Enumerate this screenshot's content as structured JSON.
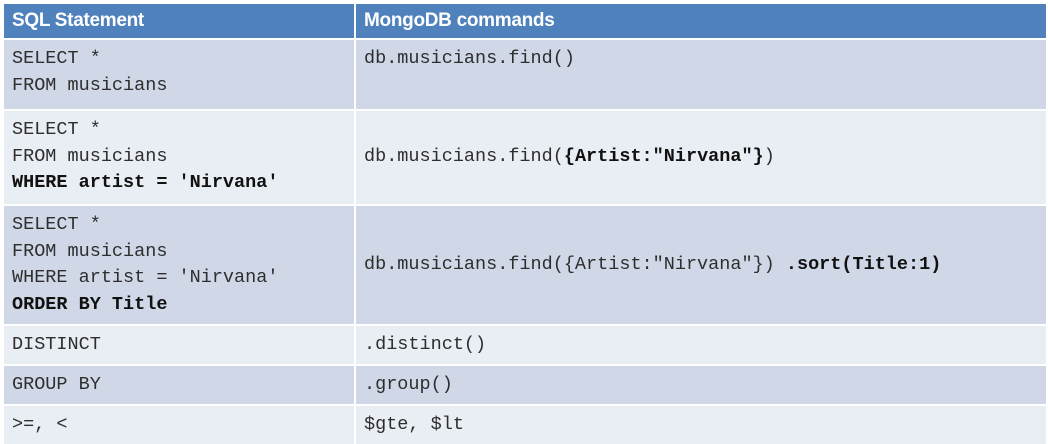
{
  "headers": {
    "sql": "SQL Statement",
    "mongo": "MongoDB commands"
  },
  "rows": [
    {
      "sql": [
        "SELECT *",
        "FROM musicians"
      ],
      "mongo": "db.musicians.find()"
    },
    {
      "sql": [
        "SELECT *",
        "FROM musicians",
        "WHERE artist = 'Nirvana'"
      ],
      "mongo_plain": "db.musicians.find(",
      "mongo_bold": "{Artist:\"Nirvana\"}",
      "mongo_end": ")"
    },
    {
      "sql": [
        "SELECT *",
        "FROM musicians",
        "WHERE artist = 'Nirvana'",
        "ORDER BY Title"
      ],
      "mongo_plain": "db.musicians.find({Artist:\"Nirvana\"}) ",
      "mongo_bold": ".sort(Title:1)"
    },
    {
      "sql": "DISTINCT",
      "mongo": ".distinct()"
    },
    {
      "sql": "GROUP BY",
      "mongo": ".group()"
    },
    {
      "sql": ">=, <",
      "mongo": "$gte, $lt"
    }
  ]
}
